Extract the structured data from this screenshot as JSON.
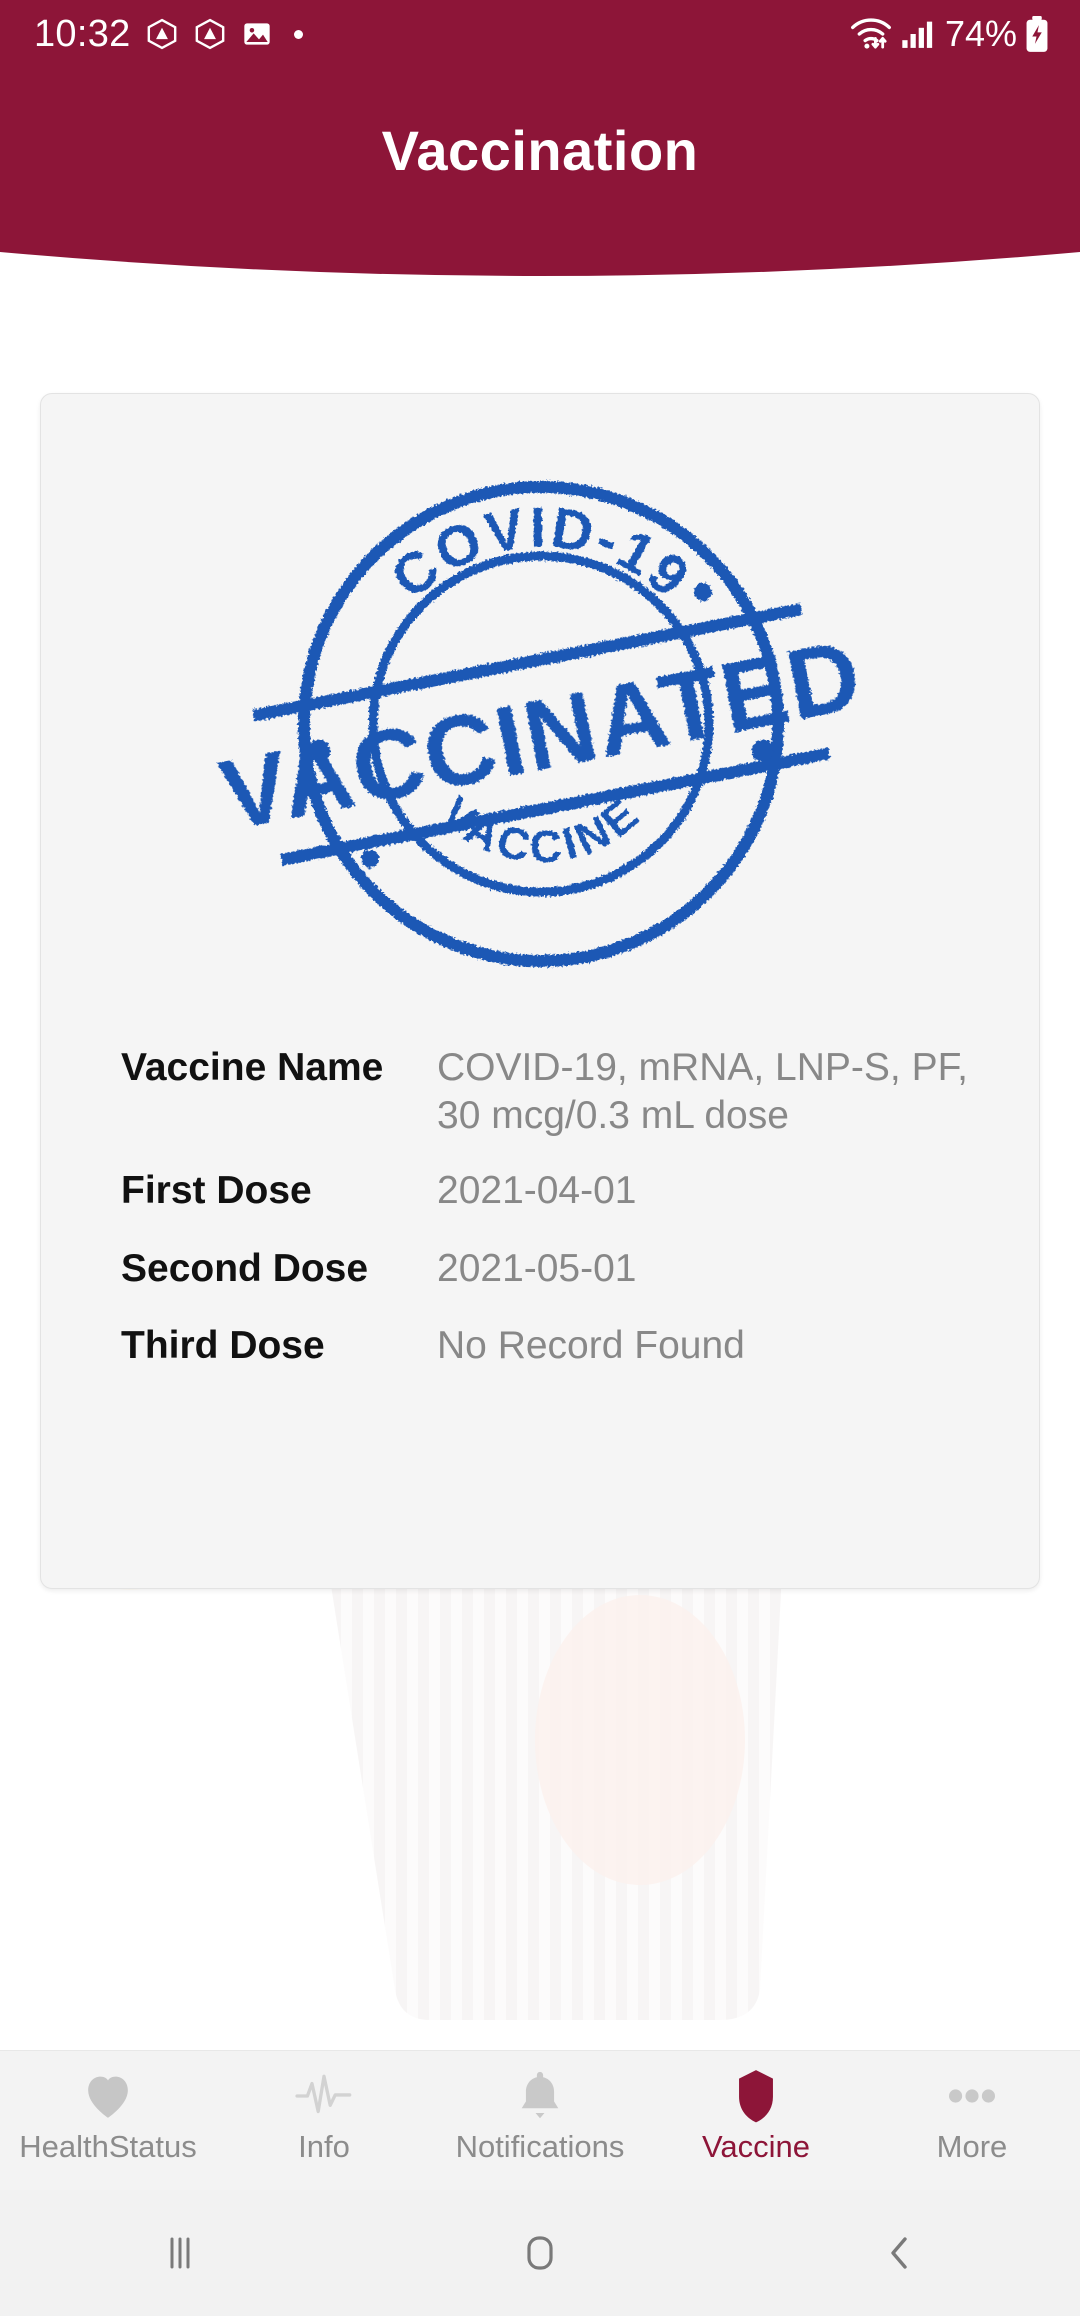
{
  "status_bar": {
    "time": "10:32",
    "battery_percent": "74%",
    "icons": [
      "adobe-triangle-icon",
      "adobe-triangle-icon",
      "gallery-image-icon",
      "notification-dot-icon",
      "wifi-icon",
      "cellular-signal-icon",
      "battery-charging-icon"
    ]
  },
  "header": {
    "title": "Vaccination",
    "background_color": "#8d1538"
  },
  "stamp": {
    "top_text": "COVID-19",
    "main_text": "VACCINATED",
    "bottom_text": "VACCINE",
    "color": "#1d58b5"
  },
  "details": {
    "rows": [
      {
        "label": "Vaccine Name",
        "value": "COVID-19, mRNA, LNP-S, PF, 30 mcg/0.3 mL dose"
      },
      {
        "label": "First Dose",
        "value": "2021-04-01"
      },
      {
        "label": "Second Dose",
        "value": "2021-05-01"
      },
      {
        "label": "Third Dose",
        "value": "No Record Found"
      }
    ]
  },
  "tabbar": {
    "active_color": "#8d1538",
    "inactive_color": "#b8b8b8",
    "items": [
      {
        "label": "HealthStatus",
        "icon": "heart-icon",
        "active": false
      },
      {
        "label": "Info",
        "icon": "pulse-wave-icon",
        "active": false
      },
      {
        "label": "Notifications",
        "icon": "bell-icon",
        "active": false
      },
      {
        "label": "Vaccine",
        "icon": "shield-icon",
        "active": true
      },
      {
        "label": "More",
        "icon": "three-dots-icon",
        "active": false
      }
    ]
  },
  "system_nav": {
    "recents_label": "Recents",
    "home_label": "Home",
    "back_label": "Back"
  }
}
